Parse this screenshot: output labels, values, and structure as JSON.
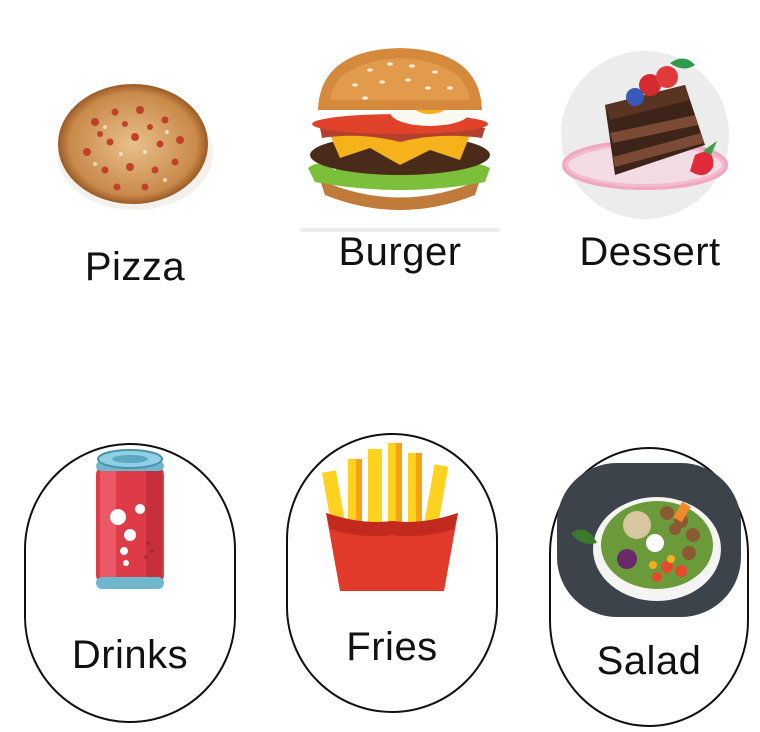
{
  "categories": [
    {
      "id": "pizza",
      "label": "Pizza"
    },
    {
      "id": "burger",
      "label": "Burger"
    },
    {
      "id": "dessert",
      "label": "Dessert"
    },
    {
      "id": "drinks",
      "label": "Drinks"
    },
    {
      "id": "fries",
      "label": "Fries"
    },
    {
      "id": "salad",
      "label": "Salad"
    }
  ],
  "icons": {
    "pizza": "pizza-icon",
    "burger": "burger-icon",
    "dessert": "cake-slice-icon",
    "drinks": "soda-can-icon",
    "fries": "french-fries-icon",
    "salad": "salad-bowl-icon"
  },
  "colors": {
    "text": "#111111",
    "outline": "#111111",
    "background": "#ffffff"
  }
}
